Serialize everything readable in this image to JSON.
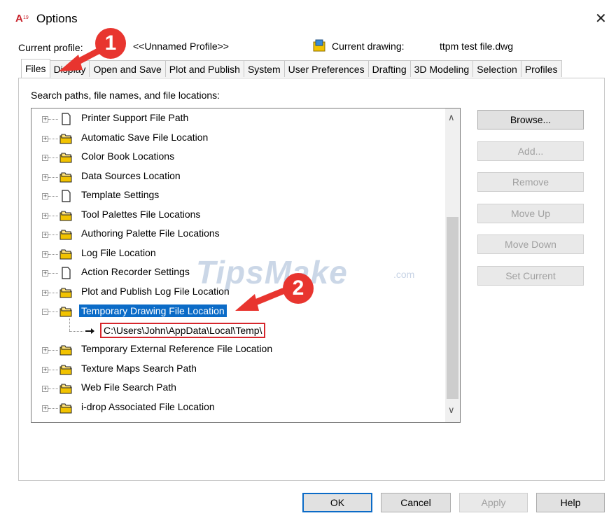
{
  "window": {
    "title": "Options",
    "close_glyph": "✕",
    "app_icon": "autocad-icon"
  },
  "profile": {
    "current_profile_label": "Current profile:",
    "current_profile_value": "<<Unnamed Profile>>",
    "current_drawing_label": "Current drawing:",
    "current_drawing_value": "ttpm test file.dwg"
  },
  "tabs": [
    {
      "label": "Files",
      "active": true
    },
    {
      "label": "Display"
    },
    {
      "label": "Open and Save"
    },
    {
      "label": "Plot and Publish"
    },
    {
      "label": "System"
    },
    {
      "label": "User Preferences"
    },
    {
      "label": "Drafting"
    },
    {
      "label": "3D Modeling"
    },
    {
      "label": "Selection"
    },
    {
      "label": "Profiles"
    }
  ],
  "files_panel": {
    "search_label": "Search paths, file names, and file locations:",
    "tree": [
      {
        "label": "Printer Support File Path",
        "icon": "document-icon"
      },
      {
        "label": "Automatic Save File Location",
        "icon": "folder-icon"
      },
      {
        "label": "Color Book Locations",
        "icon": "folder-icon"
      },
      {
        "label": "Data Sources Location",
        "icon": "folder-icon"
      },
      {
        "label": "Template Settings",
        "icon": "document-icon"
      },
      {
        "label": "Tool Palettes File Locations",
        "icon": "folder-icon"
      },
      {
        "label": "Authoring Palette File Locations",
        "icon": "folder-icon"
      },
      {
        "label": "Log File Location",
        "icon": "folder-icon"
      },
      {
        "label": "Action Recorder Settings",
        "icon": "document-icon"
      },
      {
        "label": "Plot and Publish Log File Location",
        "icon": "folder-icon"
      },
      {
        "label": "Temporary Drawing File Location",
        "icon": "folder-icon",
        "expanded": true,
        "selected": true
      },
      {
        "label": "C:\\Users\\John\\AppData\\Local\\Temp\\",
        "icon": "arrow-right-icon",
        "child": true
      },
      {
        "label": "Temporary External Reference File Location",
        "icon": "folder-icon"
      },
      {
        "label": "Texture Maps Search Path",
        "icon": "folder-icon"
      },
      {
        "label": "Web File Search Path",
        "icon": "folder-icon"
      },
      {
        "label": "i-drop Associated File Location",
        "icon": "folder-icon"
      }
    ],
    "buttons": {
      "browse": "Browse...",
      "add": "Add...",
      "remove": "Remove",
      "move_up": "Move Up",
      "move_down": "Move Down",
      "set_current": "Set Current"
    }
  },
  "footer": {
    "ok": "OK",
    "cancel": "Cancel",
    "apply": "Apply",
    "help": "Help"
  },
  "annotations": {
    "badge1": "1",
    "badge2": "2",
    "color": "#e8352f"
  },
  "watermark": {
    "text": "TipsMake",
    "domain": ".com"
  },
  "colors": {
    "selection": "#0b6bc7",
    "highlight_box": "#d6262c",
    "folder": "#f2c300"
  }
}
